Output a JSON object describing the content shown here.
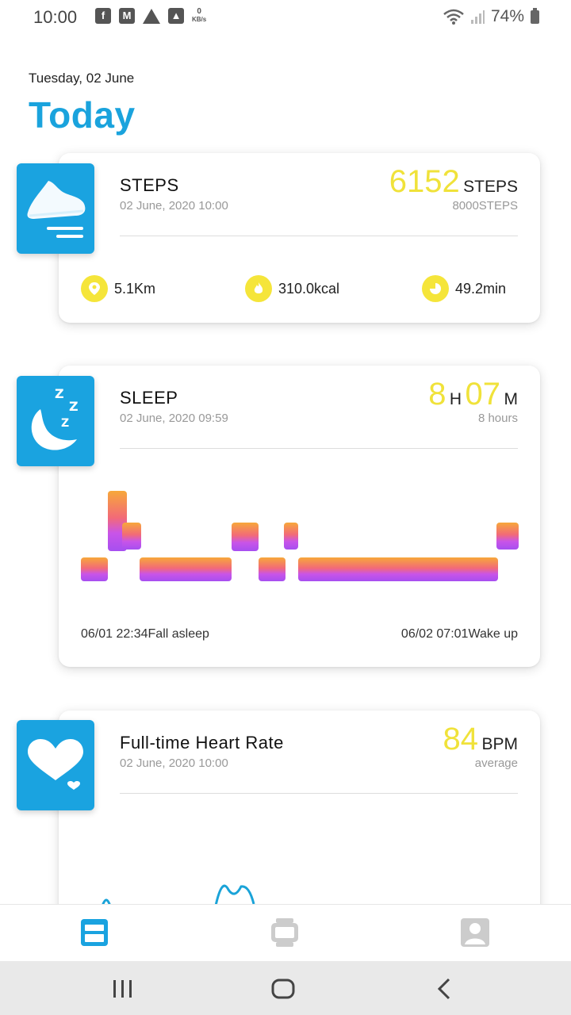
{
  "status_bar": {
    "time": "10:00",
    "speed": "0",
    "speed_unit": "KB/s",
    "battery": "74%"
  },
  "header": {
    "date": "Tuesday, 02 June",
    "title": "Today"
  },
  "steps_card": {
    "title": "STEPS",
    "timestamp": "02 June, 2020 10:00",
    "value": "6152",
    "unit": "STEPS",
    "goal": "8000STEPS",
    "distance": "5.1Km",
    "calories": "310.0kcal",
    "duration": "49.2min"
  },
  "sleep_card": {
    "title": "SLEEP",
    "timestamp": "02 June, 2020 09:59",
    "hours": "8",
    "hours_unit": "H",
    "minutes": "07",
    "minutes_unit": "M",
    "summary": "8 hours",
    "fall_asleep": "06/01 22:34Fall asleep",
    "wake_up": "06/02 07:01Wake up"
  },
  "heart_card": {
    "title": "Full-time Heart Rate",
    "timestamp": "02 June, 2020 10:00",
    "value": "84",
    "unit": "BPM",
    "summary": "average"
  },
  "colors": {
    "accent": "#1aa3e0",
    "highlight": "#f0e23a",
    "sleep_light": "#f7a23a",
    "sleep_deep": "#b24ff0"
  },
  "icons": [
    "shoe-icon",
    "moon-icon",
    "heart-icon",
    "location-icon",
    "flame-icon",
    "clock-icon",
    "dashboard-tab-icon",
    "watch-tab-icon",
    "profile-tab-icon"
  ]
}
